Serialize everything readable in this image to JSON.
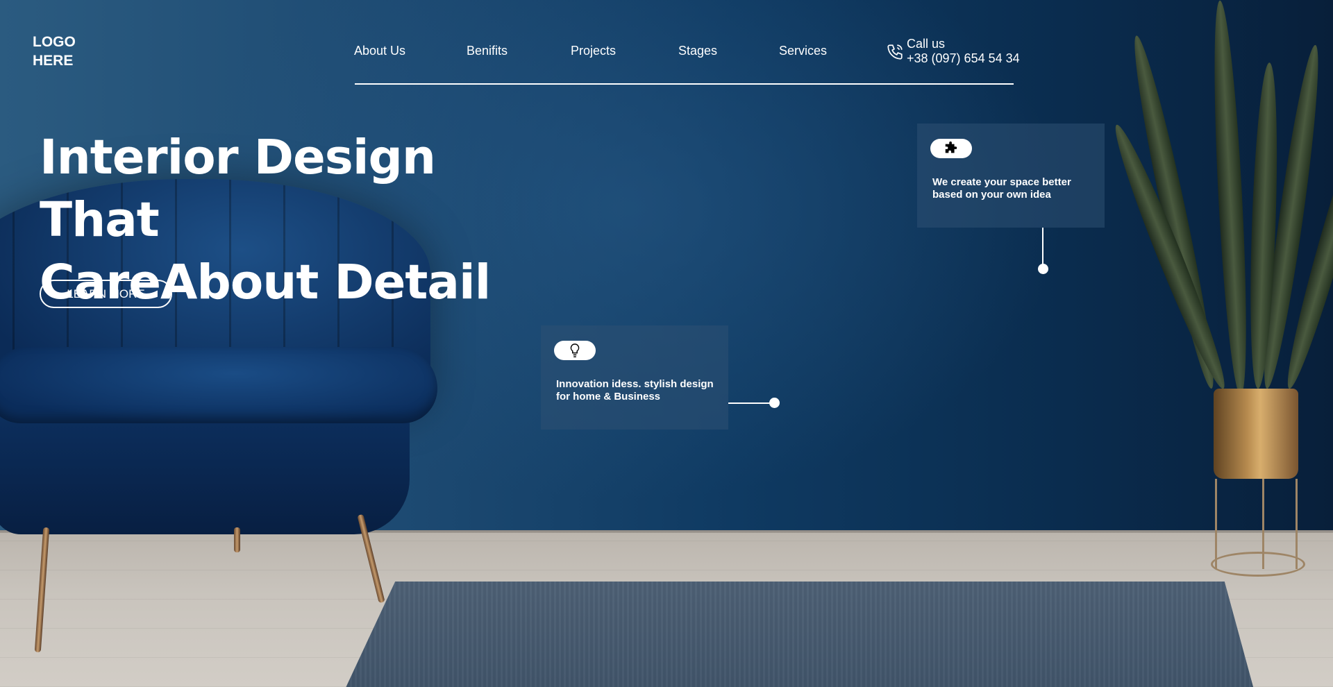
{
  "header": {
    "logo_line1": "LOGO",
    "logo_line2": "HERE",
    "nav": [
      "About Us",
      "Benifits",
      "Projects",
      "Stages",
      "Services"
    ],
    "phone_label": "Call us",
    "phone_number": "+38 (097) 654 54 34"
  },
  "hero": {
    "title_line1": "Interior Design That",
    "title_line2": "CareAbout Detail",
    "cta_label": "LEARN MORE"
  },
  "cards": [
    {
      "icon": "puzzle-icon",
      "text": "We create your space better based on your own idea"
    },
    {
      "icon": "lightbulb-icon",
      "text": "Innovation idess. stylish design for home & Business"
    }
  ],
  "colors": {
    "wall": "#0f3a62",
    "card_bg": "#2d5073",
    "text": "#ffffff"
  }
}
